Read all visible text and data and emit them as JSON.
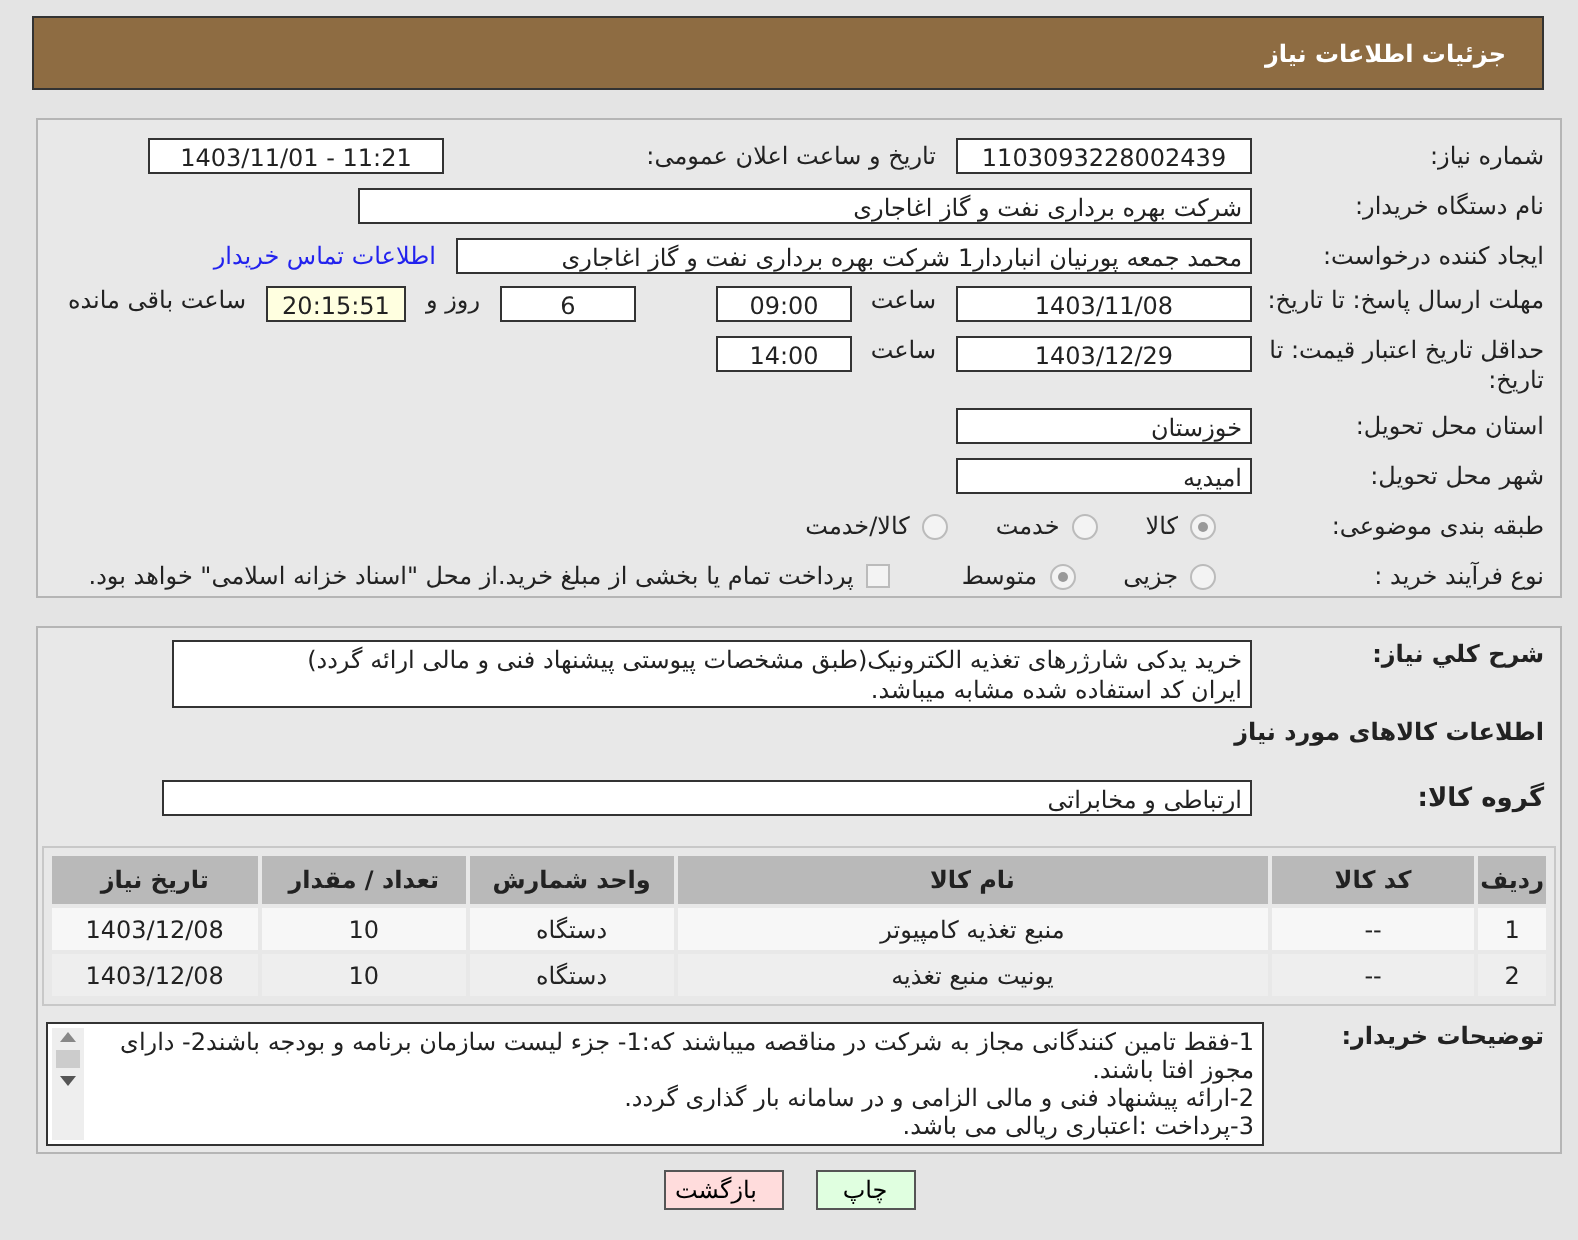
{
  "header": {
    "title": "جزئیات اطلاعات نیاز"
  },
  "need_number": {
    "label": "شماره نیاز:",
    "value": "1103093228002439"
  },
  "announce": {
    "label": "تاریخ و ساعت اعلان عمومی:",
    "value": "1403/11/01 - 11:21"
  },
  "buyer": {
    "label": "نام دستگاه خریدار:",
    "value": "شرکت بهره برداری نفت و گاز اغاجاری"
  },
  "requester": {
    "label": "ایجاد کننده درخواست:",
    "value": "محمد جمعه پورنیان انباردار1 شرکت بهره برداری نفت و گاز اغاجاری",
    "link": "اطلاعات تماس خریدار"
  },
  "reply_deadline": {
    "label": "مهلت ارسال پاسخ: تا تاریخ:",
    "date": "1403/11/08",
    "time_label": "ساعت",
    "time": "09:00",
    "days": "6",
    "days_label": "روز و",
    "remaining": "20:15:51",
    "remaining_label": "ساعت باقی مانده"
  },
  "price_validity": {
    "label": "حداقل تاریخ اعتبار قیمت: تا تاریخ:",
    "date": "1403/12/29",
    "time_label": "ساعت",
    "time": "14:00"
  },
  "province": {
    "label": "استان محل تحویل:",
    "value": "خوزستان"
  },
  "city": {
    "label": "شهر محل تحویل:",
    "value": "امیدیه"
  },
  "category": {
    "label": "طبقه بندی موضوعی:",
    "options": [
      {
        "label": "کالا",
        "selected": true
      },
      {
        "label": "خدمت",
        "selected": false
      },
      {
        "label": "کالا/خدمت",
        "selected": false
      }
    ]
  },
  "process": {
    "label": "نوع فرآیند خرید :",
    "options": [
      {
        "label": "جزیی",
        "selected": false
      },
      {
        "label": "متوسط",
        "selected": true
      }
    ],
    "treasury": {
      "label": "پرداخت تمام یا بخشی از مبلغ خرید.از محل \"اسناد خزانه اسلامی\" خواهد بود.",
      "checked": false
    }
  },
  "description": {
    "label": "شرح کلي نياز:",
    "lines": [
      "خرید یدکی شارژرهای تغذیه الکترونیک(طبق مشخصات پیوستی پیشنهاد فنی و مالی ارائه گردد)",
      "ایران کد استفاده شده مشابه میباشد."
    ]
  },
  "items_heading": "اطلاعات کالاهای مورد نیاز",
  "goods_group": {
    "label": "گروه کالا:",
    "value": "ارتباطی و مخابراتی"
  },
  "table": {
    "columns": [
      "ردیف",
      "کد کالا",
      "نام کالا",
      "واحد شمارش",
      "تعداد / مقدار",
      "تاریخ نیاز"
    ],
    "rows": [
      [
        "1",
        "--",
        "منبع تغذیه کامپیوتر",
        "دستگاه",
        "10",
        "1403/12/08"
      ],
      [
        "2",
        "--",
        "یونیت منبع تغذیه",
        "دستگاه",
        "10",
        "1403/12/08"
      ]
    ]
  },
  "buyer_notes": {
    "label": "توضیحات خریدار:",
    "lines": [
      "1-فقط تامین کنندگانی مجاز به شرکت در مناقصه میباشند که:1- جزء لیست سازمان برنامه و بودجه باشند2- دارای مجوز افتا باشند.",
      "2-ارائه پیشنهاد فنی و مالی الزامی و در سامانه بار گذاری گردد.",
      "3-پرداخت :اعتباری ریالی  می باشد."
    ]
  },
  "buttons": [
    {
      "label": "چاپ",
      "kind": "print"
    },
    {
      "label": "بازگشت",
      "kind": "back"
    }
  ]
}
